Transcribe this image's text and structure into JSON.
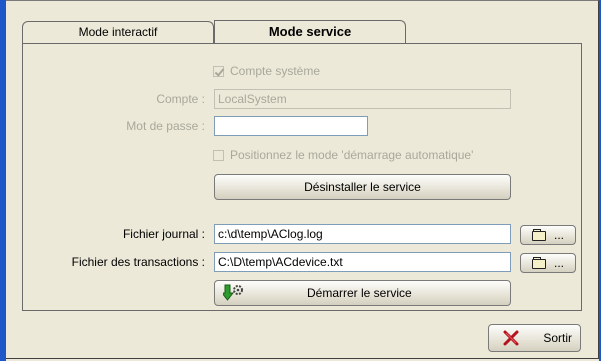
{
  "tabs": [
    {
      "label": "Mode interactif",
      "active": false
    },
    {
      "label": "Mode service",
      "active": true
    }
  ],
  "system_account": {
    "label": "Compte système",
    "checked": true,
    "enabled": false
  },
  "account": {
    "label": "Compte :",
    "value": "LocalSystem",
    "enabled": false
  },
  "password": {
    "label": "Mot de passe :",
    "value": "",
    "enabled": true
  },
  "autostart": {
    "label": "Positionnez le mode 'démarrage automatique'",
    "checked": false,
    "enabled": false
  },
  "uninstall_button": {
    "label": "Désinstaller le service"
  },
  "log_file": {
    "label": "Fichier journal :",
    "value": "c:\\d\\temp\\AClog.log",
    "browse_label": "..."
  },
  "transactions_file": {
    "label": "Fichier des transactions :",
    "value": "C:\\D\\temp\\ACdevice.txt",
    "browse_label": "..."
  },
  "start_button": {
    "label": "Démarrer le service"
  },
  "exit_button": {
    "label": "Sortir"
  },
  "colors": {
    "window_bg": "#ece9d8",
    "border_blue": "#1f56c8",
    "disabled_text": "#a8a89a",
    "exit_x": "#b5121b",
    "start_arrow": "#2e9b2e"
  },
  "icons": [
    "folder-icon",
    "green-down-arrow-icon",
    "gear-icon",
    "red-x-icon",
    "checkmark-icon"
  ]
}
